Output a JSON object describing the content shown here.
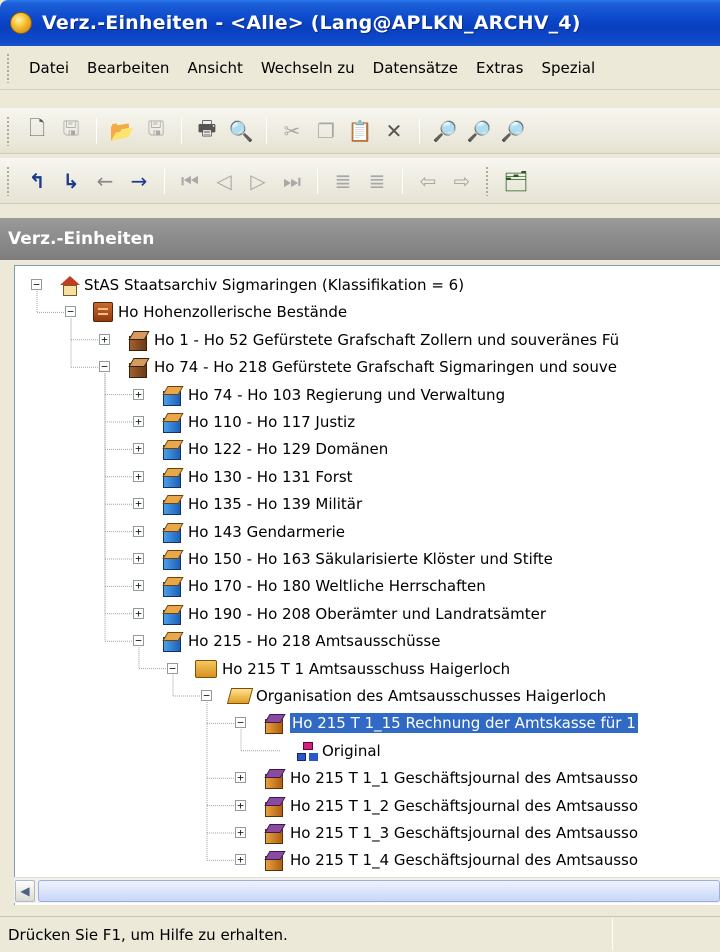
{
  "window": {
    "title": "Verz.-Einheiten - <Alle> (Lang@APLKN_ARCHV_4)"
  },
  "menubar": {
    "items": [
      {
        "label": "Datei"
      },
      {
        "label": "Bearbeiten"
      },
      {
        "label": "Ansicht"
      },
      {
        "label": "Wechseln zu"
      },
      {
        "label": "Datensätze"
      },
      {
        "label": "Extras"
      },
      {
        "label": "Spezial"
      }
    ]
  },
  "toolbar1": {
    "buttons": [
      "new-icon",
      "save-icon",
      "open-icon",
      "save-as-icon",
      "print-icon",
      "print-preview-icon",
      "cut-icon",
      "copy-icon",
      "paste-icon",
      "delete-icon",
      "find-icon",
      "find-replace-icon",
      "find-next-icon"
    ]
  },
  "toolbar2": {
    "buttons": [
      "level-up-icon",
      "level-down-icon",
      "arrow-left-icon",
      "arrow-right-icon",
      "first-record-icon",
      "previous-record-icon",
      "next-record-icon",
      "last-record-icon",
      "indent-icon",
      "outdent-icon",
      "back-icon",
      "forward-icon",
      "tree-view-icon"
    ]
  },
  "pane": {
    "header": "Verz.-Einheiten"
  },
  "tree": {
    "nodes": [
      {
        "label": "StAS  Staatsarchiv Sigmaringen (Klassifikation = 6)",
        "level": 0,
        "icon": "house-icon",
        "expander": "minus"
      },
      {
        "label": "Ho  Hohenzollerische Bestände",
        "level": 1,
        "icon": "cabinet-icon",
        "expander": "minus"
      },
      {
        "label": "Ho 1 - Ho 52  Gefürstete Grafschaft Zollern und souveränes Fü",
        "level": 2,
        "icon": "box-brown-icon",
        "expander": "plus"
      },
      {
        "label": "Ho 74 - Ho 218  Gefürstete Grafschaft Sigmaringen und souve",
        "level": 2,
        "icon": "box-brown-icon",
        "expander": "minus"
      },
      {
        "label": "Ho 74 - Ho 103  Regierung und Verwaltung",
        "level": 3,
        "icon": "box-blue-icon",
        "expander": "plus"
      },
      {
        "label": "Ho 110 - Ho 117  Justiz",
        "level": 3,
        "icon": "box-blue-icon",
        "expander": "plus"
      },
      {
        "label": "Ho 122 - Ho 129  Domänen",
        "level": 3,
        "icon": "box-blue-icon",
        "expander": "plus"
      },
      {
        "label": "Ho 130 - Ho 131  Forst",
        "level": 3,
        "icon": "box-blue-icon",
        "expander": "plus"
      },
      {
        "label": "Ho 135 - Ho 139  Militär",
        "level": 3,
        "icon": "box-blue-icon",
        "expander": "plus"
      },
      {
        "label": "Ho 143  Gendarmerie",
        "level": 3,
        "icon": "box-blue-icon",
        "expander": "plus"
      },
      {
        "label": "Ho 150 - Ho 163  Säkularisierte Klöster und Stifte",
        "level": 3,
        "icon": "box-blue-icon",
        "expander": "plus"
      },
      {
        "label": "Ho 170 - Ho 180  Weltliche Herrschaften",
        "level": 3,
        "icon": "box-blue-icon",
        "expander": "plus"
      },
      {
        "label": "Ho 190 - Ho 208  Oberämter und Landratsämter",
        "level": 3,
        "icon": "box-blue-icon",
        "expander": "plus"
      },
      {
        "label": "Ho 215 - Ho 218  Amtsausschüsse",
        "level": 3,
        "icon": "box-blue-icon",
        "expander": "minus"
      },
      {
        "label": "Ho 215 T 1  Amtsausschuss Haigerloch",
        "level": 4,
        "icon": "folder-orange-icon",
        "expander": "minus"
      },
      {
        "label": "Organisation des Amtsausschusses Haigerloch",
        "level": 5,
        "icon": "folder-open-icon",
        "expander": "minus"
      },
      {
        "label": "Ho 215 T 1_15  Rechnung der Amtskasse für 1",
        "level": 6,
        "icon": "package-icon",
        "expander": "minus",
        "selected": true
      },
      {
        "label": "Original",
        "level": 7,
        "icon": "org-chart-icon",
        "expander": "none"
      },
      {
        "label": "Ho 215 T 1_1  Geschäftsjournal des Amtsausso",
        "level": 6,
        "icon": "package-icon",
        "expander": "plus"
      },
      {
        "label": "Ho 215 T 1_2  Geschäftsjournal des Amtsausso",
        "level": 6,
        "icon": "package-icon",
        "expander": "plus"
      },
      {
        "label": "Ho 215 T 1_3  Geschäftsjournal des Amtsausso",
        "level": 6,
        "icon": "package-icon",
        "expander": "plus"
      },
      {
        "label": "Ho 215 T 1_4  Geschäftsjournal des Amtsausso",
        "level": 6,
        "icon": "package-icon",
        "expander": "plus"
      }
    ]
  },
  "statusbar": {
    "text": "Drücken Sie F1, um Hilfe zu erhalten."
  },
  "colors": {
    "titlebar": "#0a46c8",
    "selection": "#316ac5",
    "paneheader": "#8a8a8a"
  }
}
